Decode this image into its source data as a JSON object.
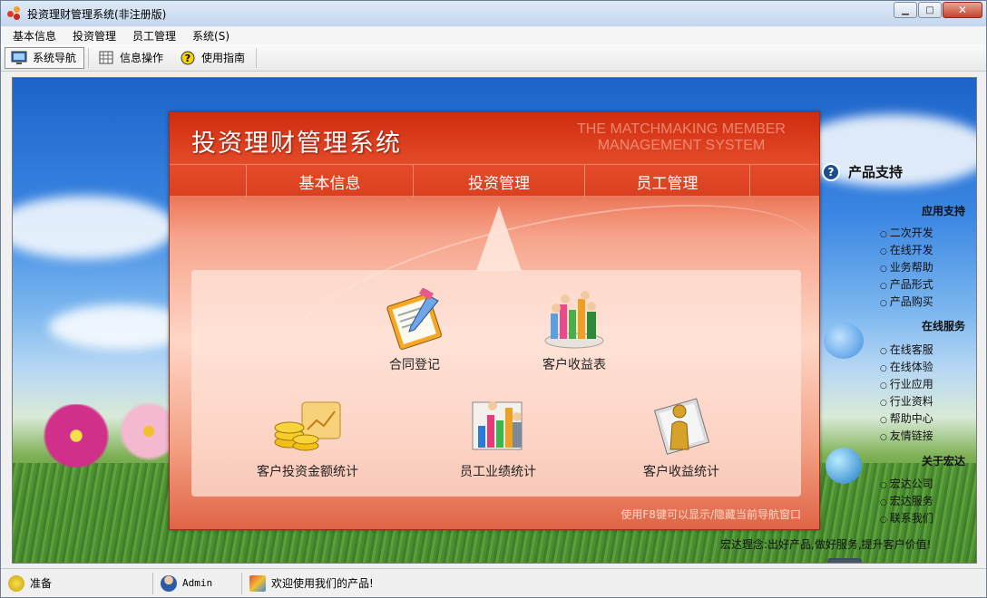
{
  "window": {
    "title": "投资理财管理系统(非注册版)",
    "controls": {
      "minimize": "▁",
      "maximize": "□",
      "close": "✕"
    }
  },
  "menu": [
    "基本信息",
    "投资管理",
    "员工管理",
    "系统(S)"
  ],
  "toolbar": [
    {
      "label": "系统导航",
      "icon": "monitor-icon",
      "active": true
    },
    {
      "label": "信息操作",
      "icon": "grid-icon",
      "active": false
    },
    {
      "label": "使用指南",
      "icon": "help-icon",
      "active": false
    }
  ],
  "panel": {
    "title": "投资理财管理系统",
    "subtitle_line1": "THE MATCHMAKING MEMBER",
    "subtitle_line2": "MANAGEMENT SYSTEM",
    "tabs": [
      "基本信息",
      "投资管理",
      "员工管理"
    ],
    "active_tab": "投资管理",
    "functions": [
      {
        "label": "合同登记",
        "icon": "contract-icon"
      },
      {
        "label": "客户收益表",
        "icon": "customer-chart-icon"
      },
      {
        "label": "客户投资金额统计",
        "icon": "coins-icon"
      },
      {
        "label": "员工业绩统计",
        "icon": "bar-chart-icon"
      },
      {
        "label": "客户收益统计",
        "icon": "person-statistics-icon"
      }
    ],
    "hint": "使用F8键可以显示/隐藏当前导航窗口"
  },
  "support": {
    "title": "产品支持",
    "sections": [
      {
        "name": "应用支持",
        "links": [
          "二次开发",
          "在线开发",
          "业务帮助",
          "产品形式",
          "产品购买"
        ]
      },
      {
        "name": "在线服务",
        "links": [
          "在线客服",
          "在线体验",
          "行业应用",
          "行业资料",
          "帮助中心",
          "友情链接"
        ]
      },
      {
        "name": "关于宏达",
        "links": [
          "宏达公司",
          "宏达服务",
          "联系我们"
        ]
      }
    ],
    "motto": "宏达理念:出好产品,做好服务,提升客户价值!"
  },
  "status": {
    "ready": "准备",
    "user": "Admin",
    "welcome": "欢迎使用我们的产品!"
  }
}
